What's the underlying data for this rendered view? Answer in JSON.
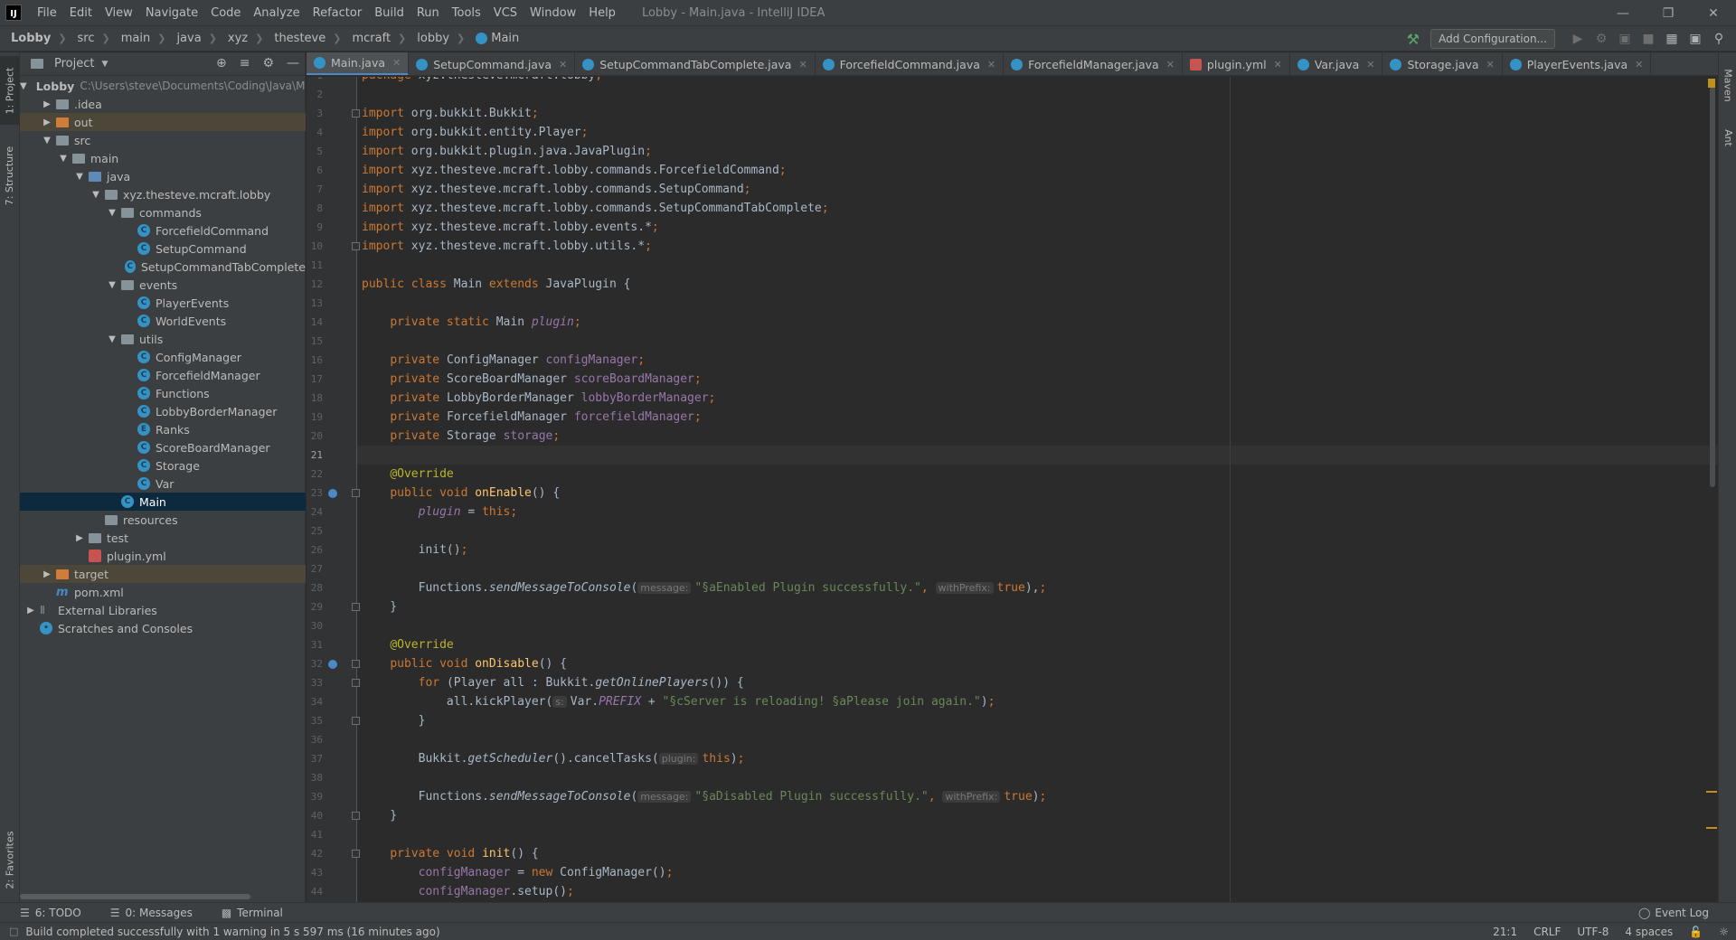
{
  "menubar": {
    "logo": "IJ",
    "items": [
      "File",
      "Edit",
      "View",
      "Navigate",
      "Code",
      "Analyze",
      "Refactor",
      "Build",
      "Run",
      "Tools",
      "VCS",
      "Window",
      "Help"
    ],
    "window_title": "Lobby - Main.java - IntelliJ IDEA"
  },
  "navbar": {
    "breadcrumbs": [
      "Lobby",
      "src",
      "main",
      "java",
      "xyz",
      "thesteve",
      "mcraft",
      "lobby",
      "Main"
    ],
    "add_configuration": "Add Configuration..."
  },
  "tool_windows": {
    "left": [
      "1: Project",
      "7: Structure",
      "2: Favorites"
    ],
    "right": [
      "Maven",
      "Ant"
    ],
    "bottom": [
      "6: TODO",
      "0: Messages",
      "Terminal"
    ],
    "event_log": "Event Log"
  },
  "project_panel": {
    "title": "Project",
    "tree": [
      {
        "label": "Lobby",
        "hint": "C:\\Users\\steve\\Documents\\Coding\\Java\\Mine",
        "depth": 0,
        "arrow": "down",
        "icon": "folder-module"
      },
      {
        "label": ".idea",
        "depth": 1,
        "arrow": "right",
        "icon": "folder"
      },
      {
        "label": "out",
        "depth": 1,
        "arrow": "right",
        "icon": "folder-excluded",
        "excluded": true
      },
      {
        "label": "src",
        "depth": 1,
        "arrow": "down",
        "icon": "folder"
      },
      {
        "label": "main",
        "depth": 2,
        "arrow": "down",
        "icon": "folder"
      },
      {
        "label": "java",
        "depth": 3,
        "arrow": "down",
        "icon": "folder-source"
      },
      {
        "label": "xyz.thesteve.mcraft.lobby",
        "depth": 4,
        "arrow": "down",
        "icon": "package"
      },
      {
        "label": "commands",
        "depth": 5,
        "arrow": "down",
        "icon": "package"
      },
      {
        "label": "ForcefieldCommand",
        "depth": 6,
        "arrow": "",
        "icon": "class"
      },
      {
        "label": "SetupCommand",
        "depth": 6,
        "arrow": "",
        "icon": "class"
      },
      {
        "label": "SetupCommandTabComplete",
        "depth": 6,
        "arrow": "",
        "icon": "class"
      },
      {
        "label": "events",
        "depth": 5,
        "arrow": "down",
        "icon": "package"
      },
      {
        "label": "PlayerEvents",
        "depth": 6,
        "arrow": "",
        "icon": "class"
      },
      {
        "label": "WorldEvents",
        "depth": 6,
        "arrow": "",
        "icon": "class"
      },
      {
        "label": "utils",
        "depth": 5,
        "arrow": "down",
        "icon": "package"
      },
      {
        "label": "ConfigManager",
        "depth": 6,
        "arrow": "",
        "icon": "class"
      },
      {
        "label": "ForcefieldManager",
        "depth": 6,
        "arrow": "",
        "icon": "class"
      },
      {
        "label": "Functions",
        "depth": 6,
        "arrow": "",
        "icon": "class"
      },
      {
        "label": "LobbyBorderManager",
        "depth": 6,
        "arrow": "",
        "icon": "class"
      },
      {
        "label": "Ranks",
        "depth": 6,
        "arrow": "",
        "icon": "enum"
      },
      {
        "label": "ScoreBoardManager",
        "depth": 6,
        "arrow": "",
        "icon": "class"
      },
      {
        "label": "Storage",
        "depth": 6,
        "arrow": "",
        "icon": "class"
      },
      {
        "label": "Var",
        "depth": 6,
        "arrow": "",
        "icon": "class"
      },
      {
        "label": "Main",
        "depth": 5,
        "arrow": "",
        "icon": "class",
        "selected": true
      },
      {
        "label": "resources",
        "depth": 4,
        "arrow": "",
        "icon": "folder-resources"
      },
      {
        "label": "test",
        "depth": 3,
        "arrow": "right",
        "icon": "folder"
      },
      {
        "label": "plugin.yml",
        "depth": 3,
        "arrow": "",
        "icon": "yml"
      },
      {
        "label": "target",
        "depth": 1,
        "arrow": "right",
        "icon": "folder-excluded",
        "excluded": true
      },
      {
        "label": "pom.xml",
        "depth": 1,
        "arrow": "",
        "icon": "maven"
      },
      {
        "label": "External Libraries",
        "depth": 0,
        "arrow": "right",
        "icon": "libraries"
      },
      {
        "label": "Scratches and Consoles",
        "depth": 0,
        "arrow": "",
        "icon": "scratches"
      }
    ]
  },
  "editor_tabs": [
    {
      "label": "Main.java",
      "active": true
    },
    {
      "label": "SetupCommand.java"
    },
    {
      "label": "SetupCommandTabComplete.java"
    },
    {
      "label": "ForcefieldCommand.java"
    },
    {
      "label": "ForcefieldManager.java"
    },
    {
      "label": "plugin.yml",
      "yml": true
    },
    {
      "label": "Var.java"
    },
    {
      "label": "Storage.java"
    },
    {
      "label": "PlayerEvents.java"
    }
  ],
  "editor": {
    "current_line": 21,
    "first_line": 1,
    "lines": [
      [
        [
          "kw",
          "package "
        ],
        [
          "",
          "xyz.thesteve.mcraft.lobby"
        ],
        [
          "kw",
          ";"
        ]
      ],
      [],
      [
        [
          "kw",
          "import "
        ],
        [
          "",
          "org.bukkit.Bukkit"
        ],
        [
          "kw",
          ";"
        ]
      ],
      [
        [
          "kw",
          "import "
        ],
        [
          "",
          "org.bukkit.entity.Player"
        ],
        [
          "kw",
          ";"
        ]
      ],
      [
        [
          "kw",
          "import "
        ],
        [
          "",
          "org.bukkit.plugin.java.JavaPlugin"
        ],
        [
          "kw",
          ";"
        ]
      ],
      [
        [
          "kw",
          "import "
        ],
        [
          "",
          "xyz.thesteve.mcraft.lobby.commands.ForcefieldCommand"
        ],
        [
          "kw",
          ";"
        ]
      ],
      [
        [
          "kw",
          "import "
        ],
        [
          "",
          "xyz.thesteve.mcraft.lobby.commands.SetupCommand"
        ],
        [
          "kw",
          ";"
        ]
      ],
      [
        [
          "kw",
          "import "
        ],
        [
          "",
          "xyz.thesteve.mcraft.lobby.commands.SetupCommandTabComplete"
        ],
        [
          "kw",
          ";"
        ]
      ],
      [
        [
          "kw",
          "import "
        ],
        [
          "",
          "xyz.thesteve.mcraft.lobby.events.*"
        ],
        [
          "kw",
          ";"
        ]
      ],
      [
        [
          "kw",
          "import "
        ],
        [
          "",
          "xyz.thesteve.mcraft.lobby.utils.*"
        ],
        [
          "kw",
          ";"
        ]
      ],
      [],
      [
        [
          "kw",
          "public class "
        ],
        [
          "",
          "Main "
        ],
        [
          "kw",
          "extends "
        ],
        [
          "",
          "JavaPlugin {"
        ]
      ],
      [],
      [
        [
          "",
          "    "
        ],
        [
          "kw",
          "private static "
        ],
        [
          "",
          "Main "
        ],
        [
          "ifld",
          "plugin"
        ],
        [
          "kw",
          ";"
        ]
      ],
      [],
      [
        [
          "",
          "    "
        ],
        [
          "kw",
          "private "
        ],
        [
          "",
          "ConfigManager "
        ],
        [
          "fld",
          "configManager"
        ],
        [
          "kw",
          ";"
        ]
      ],
      [
        [
          "",
          "    "
        ],
        [
          "kw",
          "private "
        ],
        [
          "",
          "ScoreBoardManager "
        ],
        [
          "fld",
          "scoreBoardManager"
        ],
        [
          "kw",
          ";"
        ]
      ],
      [
        [
          "",
          "    "
        ],
        [
          "kw",
          "private "
        ],
        [
          "",
          "LobbyBorderManager "
        ],
        [
          "fld",
          "lobbyBorderManager"
        ],
        [
          "kw",
          ";"
        ]
      ],
      [
        [
          "",
          "    "
        ],
        [
          "kw",
          "private "
        ],
        [
          "",
          "ForcefieldManager "
        ],
        [
          "fld",
          "forcefieldManager"
        ],
        [
          "kw",
          ";"
        ]
      ],
      [
        [
          "",
          "    "
        ],
        [
          "kw",
          "private "
        ],
        [
          "",
          "Storage "
        ],
        [
          "fld",
          "storage"
        ],
        [
          "kw",
          ";"
        ]
      ],
      [],
      [
        [
          "",
          "    "
        ],
        [
          "ann",
          "@Override"
        ]
      ],
      [
        [
          "",
          "    "
        ],
        [
          "kw",
          "public void "
        ],
        [
          "mth",
          "onEnable"
        ],
        [
          "",
          "() {"
        ]
      ],
      [
        [
          "",
          "        "
        ],
        [
          "ifld",
          "plugin "
        ],
        [
          "",
          "= "
        ],
        [
          "kw",
          "this;"
        ]
      ],
      [],
      [
        [
          "",
          "        init()"
        ],
        [
          "kw",
          ";"
        ]
      ],
      [],
      [
        [
          "",
          "        Functions."
        ],
        [
          "ist",
          "sendMessageToConsole"
        ],
        [
          "",
          "("
        ],
        [
          "hint",
          "message:"
        ],
        [
          "str",
          "\"§aEnabled Plugin successfully.\""
        ],
        [
          "kw",
          ", "
        ],
        [
          "hint",
          "withPrefix:"
        ],
        [
          "kw",
          "true"
        ],
        [
          "",
          "),"
        ],
        [
          "kw",
          ";"
        ]
      ],
      [
        [
          "",
          "    }"
        ]
      ],
      [],
      [
        [
          "",
          "    "
        ],
        [
          "ann",
          "@Override"
        ]
      ],
      [
        [
          "",
          "    "
        ],
        [
          "kw",
          "public void "
        ],
        [
          "mth",
          "onDisable"
        ],
        [
          "",
          "() {"
        ]
      ],
      [
        [
          "",
          "        "
        ],
        [
          "kw",
          "for "
        ],
        [
          "",
          "(Player all : Bukkit."
        ],
        [
          "ist",
          "getOnlinePlayers"
        ],
        [
          "",
          "()) {"
        ]
      ],
      [
        [
          "",
          "            all.kickPlayer("
        ],
        [
          "hint",
          "s:"
        ],
        [
          "",
          "Var."
        ],
        [
          "ifld",
          "PREFIX"
        ],
        [
          "",
          " + "
        ],
        [
          "str",
          "\"§cServer is reloading! §aPlease join again.\""
        ],
        [
          "",
          ")"
        ],
        [
          "kw",
          ";"
        ]
      ],
      [
        [
          "",
          "        }"
        ]
      ],
      [],
      [
        [
          "",
          "        Bukkit."
        ],
        [
          "ist",
          "getScheduler"
        ],
        [
          "",
          "().cancelTasks("
        ],
        [
          "hint",
          "plugin:"
        ],
        [
          "kw",
          "this"
        ],
        [
          "",
          ")"
        ],
        [
          "kw",
          ";"
        ]
      ],
      [],
      [
        [
          "",
          "        Functions."
        ],
        [
          "ist",
          "sendMessageToConsole"
        ],
        [
          "",
          "("
        ],
        [
          "hint",
          "message:"
        ],
        [
          "str",
          "\"§aDisabled Plugin successfully.\""
        ],
        [
          "kw",
          ", "
        ],
        [
          "hint",
          "withPrefix:"
        ],
        [
          "kw",
          "true"
        ],
        [
          "",
          ")"
        ],
        [
          "kw",
          ";"
        ]
      ],
      [
        [
          "",
          "    }"
        ]
      ],
      [],
      [
        [
          "",
          "    "
        ],
        [
          "kw",
          "private void "
        ],
        [
          "mth",
          "init"
        ],
        [
          "",
          "() {"
        ]
      ],
      [
        [
          "",
          "        "
        ],
        [
          "fld",
          "configManager "
        ],
        [
          "",
          "= "
        ],
        [
          "kw",
          "new "
        ],
        [
          "",
          "ConfigManager()"
        ],
        [
          "kw",
          ";"
        ]
      ],
      [
        [
          "",
          "        "
        ],
        [
          "fld",
          "configManager"
        ],
        [
          "",
          ".setup()"
        ],
        [
          "kw",
          ";"
        ]
      ]
    ]
  },
  "status": {
    "message": "Build completed successfully with 1 warning in 5 s 597 ms (16 minutes ago)",
    "position": "21:1",
    "line_separator": "CRLF",
    "encoding": "UTF-8",
    "indent": "4 spaces"
  },
  "colors": {
    "keyword": "#cc7832",
    "string": "#6a8759",
    "field": "#9876aa",
    "annotation": "#bbb529",
    "method": "#ffc66d",
    "selection": "#0d293e",
    "excluded": "#4d473a",
    "active_tab_underline": "#4a88c7"
  }
}
